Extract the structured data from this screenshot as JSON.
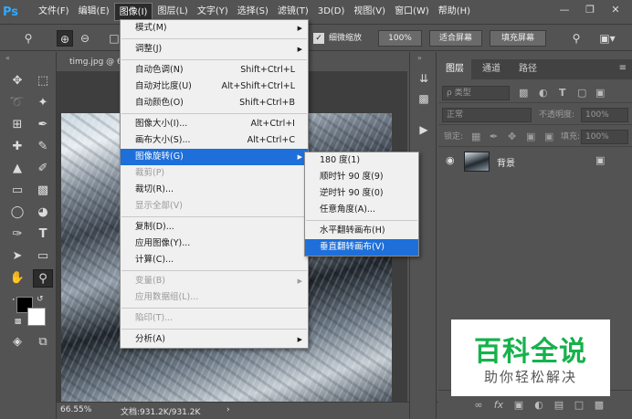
{
  "app": {
    "logo": "Ps",
    "menubar": [
      "文件(F)",
      "编辑(E)",
      "图像(I)",
      "图层(L)",
      "文字(Y)",
      "选择(S)",
      "滤镜(T)",
      "3D(D)",
      "视图(V)",
      "窗口(W)",
      "帮助(H)"
    ],
    "active_menu_index": 2
  },
  "options_bar": {
    "fine_zoom_label": "细微缩放",
    "zoom_value": "100%",
    "fit_screen": "适合屏幕",
    "fill_screen": "填充屏幕"
  },
  "document": {
    "tab_title": "timg.jpg @ 6",
    "zoom": "66.55%",
    "doc_info": "文档:931.2K/931.2K"
  },
  "image_menu": [
    {
      "label": "模式(M)",
      "submenu": true
    },
    {
      "sep": true
    },
    {
      "label": "调整(J)",
      "submenu": true
    },
    {
      "sep": true
    },
    {
      "label": "自动色调(N)",
      "shortcut": "Shift+Ctrl+L"
    },
    {
      "label": "自动对比度(U)",
      "shortcut": "Alt+Shift+Ctrl+L"
    },
    {
      "label": "自动颜色(O)",
      "shortcut": "Shift+Ctrl+B"
    },
    {
      "sep": true
    },
    {
      "label": "图像大小(I)...",
      "shortcut": "Alt+Ctrl+I"
    },
    {
      "label": "画布大小(S)...",
      "shortcut": "Alt+Ctrl+C"
    },
    {
      "label": "图像旋转(G)",
      "submenu": true,
      "highlighted": true
    },
    {
      "label": "裁剪(P)",
      "disabled": true
    },
    {
      "label": "裁切(R)..."
    },
    {
      "label": "显示全部(V)",
      "disabled": true
    },
    {
      "sep": true
    },
    {
      "label": "复制(D)..."
    },
    {
      "label": "应用图像(Y)..."
    },
    {
      "label": "计算(C)..."
    },
    {
      "sep": true
    },
    {
      "label": "变量(B)",
      "submenu": true,
      "disabled": true
    },
    {
      "label": "应用数据组(L)...",
      "disabled": true
    },
    {
      "sep": true
    },
    {
      "label": "陷印(T)...",
      "disabled": true
    },
    {
      "sep": true
    },
    {
      "label": "分析(A)",
      "submenu": true
    }
  ],
  "rotate_submenu": [
    {
      "label": "180 度(1)"
    },
    {
      "label": "顺时针 90 度(9)"
    },
    {
      "label": "逆时针 90 度(0)"
    },
    {
      "label": "任意角度(A)..."
    },
    {
      "sep": true
    },
    {
      "label": "水平翻转画布(H)"
    },
    {
      "label": "垂直翻转画布(V)",
      "highlighted": true
    }
  ],
  "layers_panel": {
    "tabs": [
      "图层",
      "通道",
      "路径"
    ],
    "filter_label": "ρ 类型",
    "blend_mode": "正常",
    "opacity_label": "不透明度:",
    "opacity_value": "100%",
    "lock_label": "锁定:",
    "fill_label": "填充:",
    "fill_value": "100%",
    "layer_name": "背景"
  },
  "watermark": {
    "main": "百科全说",
    "sub": "助你轻松解决"
  }
}
